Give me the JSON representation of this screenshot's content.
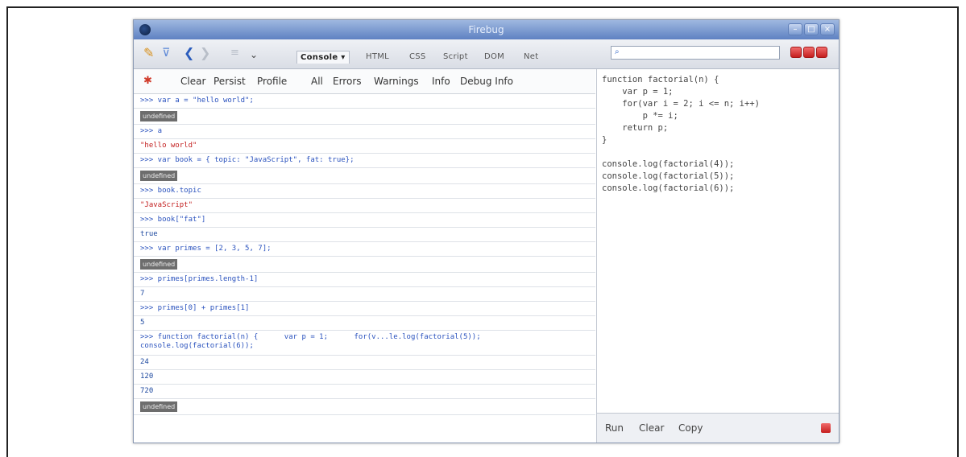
{
  "window": {
    "title": "Firebug"
  },
  "toolbar": {
    "tabs": [
      "Console ▾",
      "HTML",
      "CSS",
      "Script",
      "DOM",
      "Net"
    ]
  },
  "filters": {
    "buttons": [
      "Clear",
      "Persist",
      "Profile"
    ],
    "levels": [
      "All",
      "Errors",
      "Warnings",
      "Info",
      "Debug Info"
    ]
  },
  "console": {
    "undefined_label": "undefined",
    "rows": [
      ">>> var a = \"hello world\";",
      ">>> a",
      "\"hello world\"",
      ">>> var book = { topic: \"JavaScript\", fat: true};",
      ">>> book.topic",
      "\"JavaScript\"",
      ">>> book[\"fat\"]",
      "true",
      ">>> var primes = [2, 3, 5, 7];",
      ">>> primes[primes.length-1]",
      "7",
      ">>> primes[0] + primes[1]",
      "5",
      ">>> function factorial(n) {      var p = 1;      for(v...le.log(factorial(5));",
      "console.log(factorial(6));",
      "24",
      "120",
      "720"
    ]
  },
  "editor": {
    "code": "function factorial(n) {\n    var p = 1;\n    for(var i = 2; i <= n; i++)\n        p *= i;\n    return p;\n}\n\nconsole.log(factorial(4));\nconsole.log(factorial(5));\nconsole.log(factorial(6));"
  },
  "bottom": {
    "buttons": [
      "Run",
      "Clear",
      "Copy"
    ]
  }
}
